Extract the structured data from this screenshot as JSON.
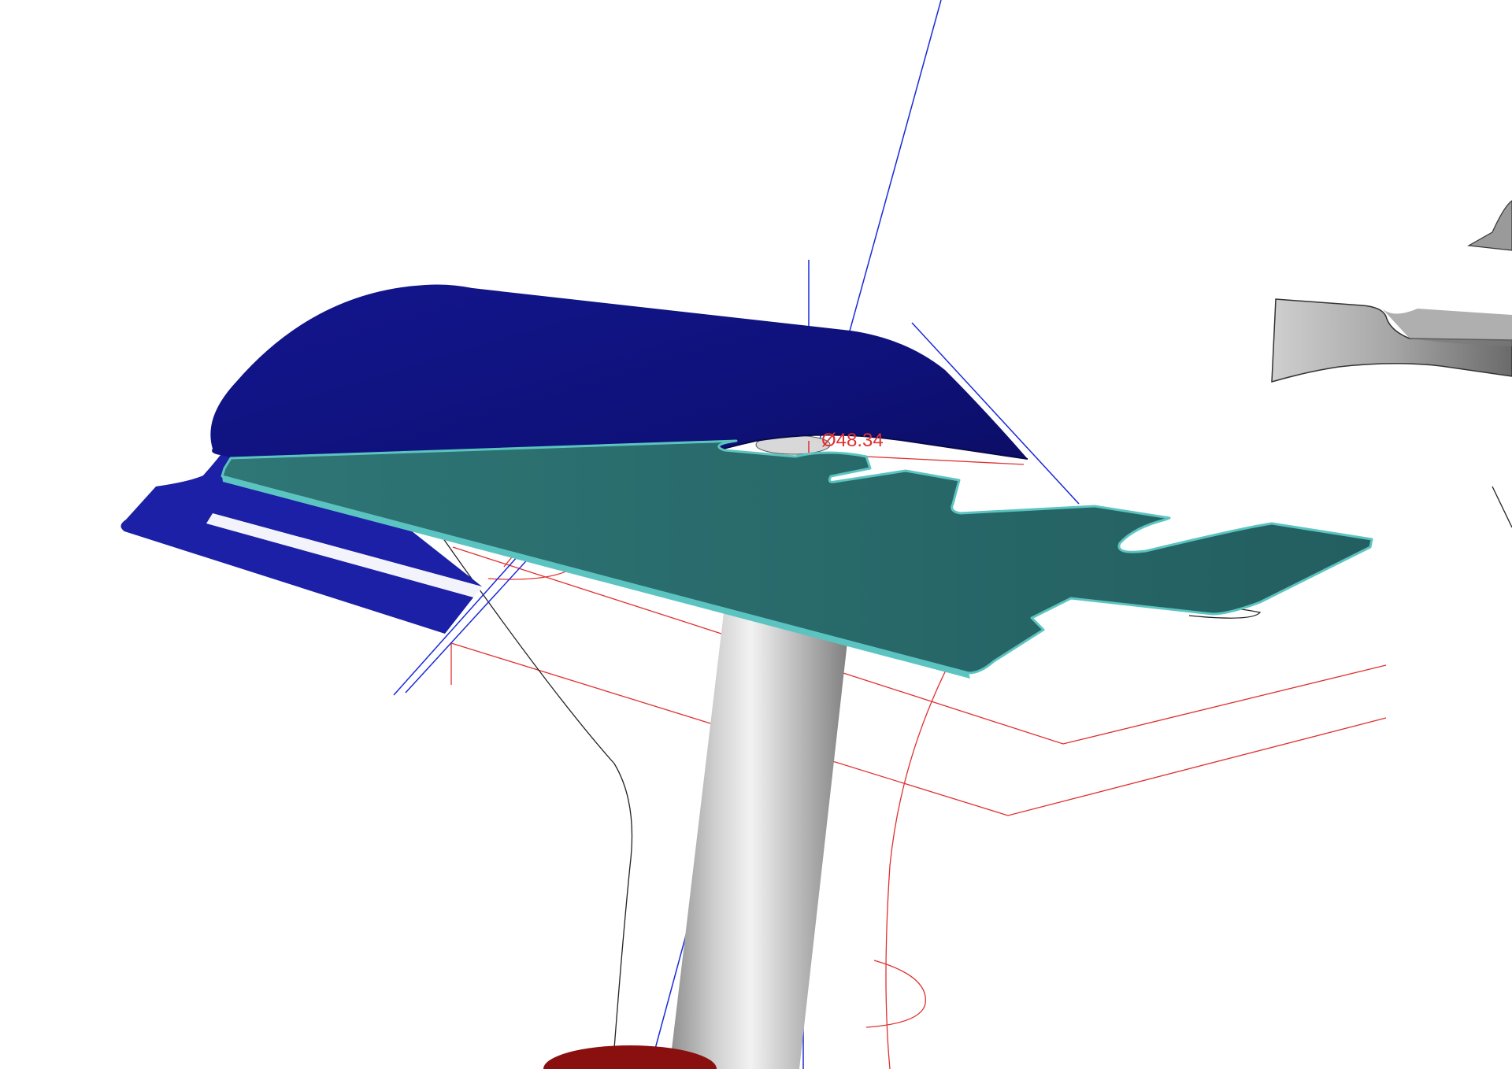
{
  "viewport": {
    "background": "#ffffff",
    "colors": {
      "canopy": "#101484",
      "canopy_dark": "#0b0e6a",
      "plate": "#2b6e6e",
      "plate_edge": "#5cc4c0",
      "pole_light": "#e6e6e6",
      "pole_dark": "#8a8a8a",
      "guide_blue": "#1a2ad8",
      "guide_red": "#e03030",
      "sketch_black": "#222222",
      "base_red": "#8a1010"
    }
  },
  "annotations": {
    "diameter_label": "Ø48.34"
  },
  "objects": [
    {
      "name": "canopy-surface",
      "type": "surface"
    },
    {
      "name": "cutout-plate",
      "type": "surface"
    },
    {
      "name": "pole-cylinder",
      "type": "solid"
    },
    {
      "name": "base-disc",
      "type": "solid"
    },
    {
      "name": "clamp-part",
      "type": "solid"
    },
    {
      "name": "bracket-part",
      "type": "solid"
    }
  ]
}
